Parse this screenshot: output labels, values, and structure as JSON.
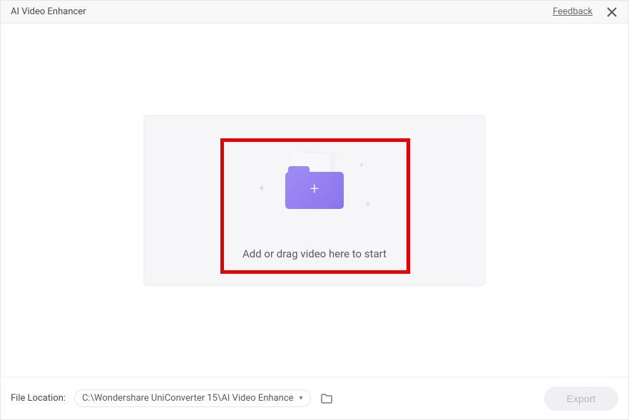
{
  "titlebar": {
    "title": "AI Video Enhancer",
    "feedback": "Feedback"
  },
  "dropzone": {
    "text": "Add or drag video here to start"
  },
  "bottombar": {
    "file_location_label": "File Location:",
    "path": "C:\\Wondershare UniConverter 15\\AI Video Enhance",
    "export_label": "Export"
  },
  "icons": {
    "close": "close-icon",
    "folder": "folder-icon",
    "caret": "▾"
  }
}
